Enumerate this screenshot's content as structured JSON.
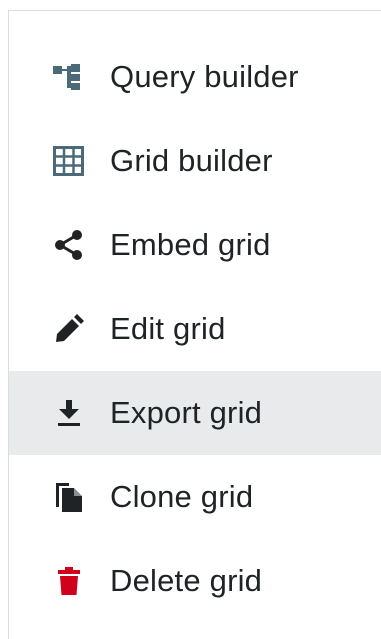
{
  "menu": {
    "items": [
      {
        "label": "Query builder",
        "icon": "query-builder-icon",
        "icon_color": "#4a6a78"
      },
      {
        "label": "Grid builder",
        "icon": "grid-icon",
        "icon_color": "#4a6a78"
      },
      {
        "label": "Embed grid",
        "icon": "share-icon",
        "icon_color": "#1f2326"
      },
      {
        "label": "Edit grid",
        "icon": "pencil-icon",
        "icon_color": "#1f2326"
      },
      {
        "label": "Export grid",
        "icon": "download-icon",
        "icon_color": "#1f2326",
        "highlighted": true
      },
      {
        "label": "Clone grid",
        "icon": "copy-icon",
        "icon_color": "#1f2326"
      },
      {
        "label": "Delete grid",
        "icon": "trash-icon",
        "icon_color": "#d0021b"
      }
    ]
  },
  "colors": {
    "highlight_bg": "#e8eaeb",
    "text": "#1f2326",
    "delete_red": "#d0021b"
  }
}
